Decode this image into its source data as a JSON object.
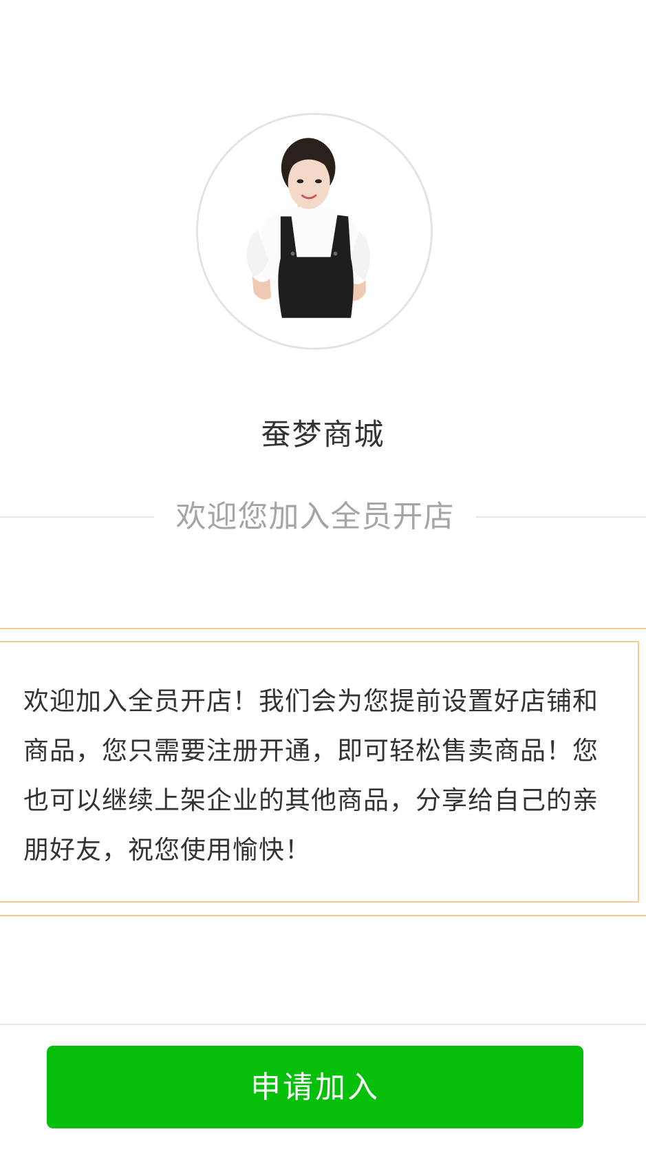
{
  "profile": {
    "avatar_alt": "店主头像",
    "shop_name": "蚕梦商城"
  },
  "welcome": {
    "title": "欢迎您加入全员开店"
  },
  "intro": {
    "text": "欢迎加入全员开店！我们会为您提前设置好店铺和商品，您只需要注册开通，即可轻松售卖商品！您也可以继续上架企业的其他商品，分享给自己的亲朋好友，祝您使用愉快！"
  },
  "actions": {
    "apply_label": "申请加入"
  },
  "colors": {
    "primary_button": "#05bf0a",
    "intro_border": "#f6c98e",
    "divider": "#e6e6e6",
    "muted_text": "#a5a5a5"
  }
}
